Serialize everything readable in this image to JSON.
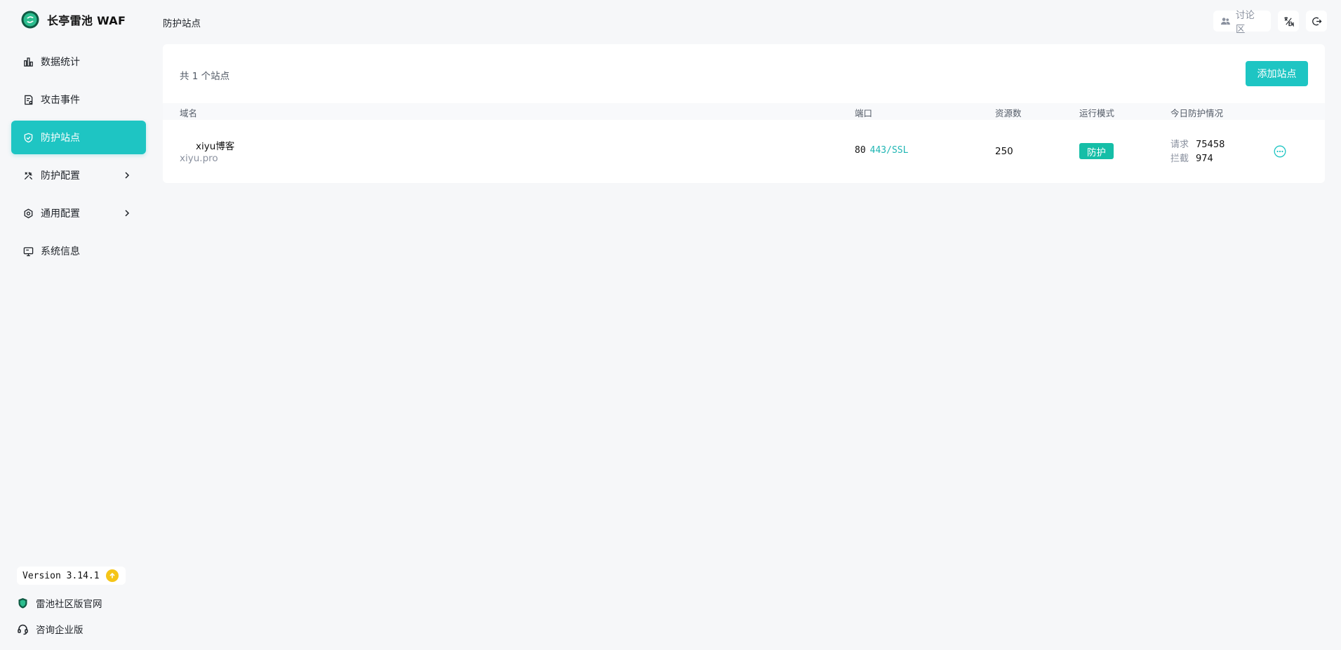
{
  "app": {
    "name": "长亭雷池 WAF"
  },
  "sidebar": {
    "items": [
      {
        "label": "数据统计",
        "icon": "bar-chart-icon"
      },
      {
        "label": "攻击事件",
        "icon": "document-alert-icon"
      },
      {
        "label": "防护站点",
        "icon": "shield-icon",
        "active": true
      },
      {
        "label": "防护配置",
        "icon": "tools-icon",
        "expandable": true
      },
      {
        "label": "通用配置",
        "icon": "gear-icon",
        "expandable": true
      },
      {
        "label": "系统信息",
        "icon": "monitor-icon"
      }
    ],
    "version": "Version 3.14.1",
    "links": [
      {
        "label": "雷池社区版官网",
        "icon": "shield-logo-icon"
      },
      {
        "label": "咨询企业版",
        "icon": "headset-icon"
      }
    ]
  },
  "header": {
    "title": "防护站点",
    "forum_label": "讨论区"
  },
  "main": {
    "count_text": "共 1 个站点",
    "add_button": "添加站点",
    "columns": {
      "domain": "域名",
      "port": "端口",
      "resources": "资源数",
      "mode": "运行模式",
      "today": "今日防护情况"
    },
    "rows": [
      {
        "name": "xiyu博客",
        "domain": "xiyu.pro",
        "port_http": "80",
        "port_ssl": "443/SSL",
        "resources": "250",
        "mode": "防护",
        "requests_label": "请求",
        "requests": "75458",
        "blocked_label": "拦截",
        "blocked": "974"
      }
    ]
  },
  "colors": {
    "accent": "#1ec5c3",
    "mode_badge": "#15bea7",
    "ssl_text": "#1eb5b3",
    "update_badge": "#f5c518"
  }
}
